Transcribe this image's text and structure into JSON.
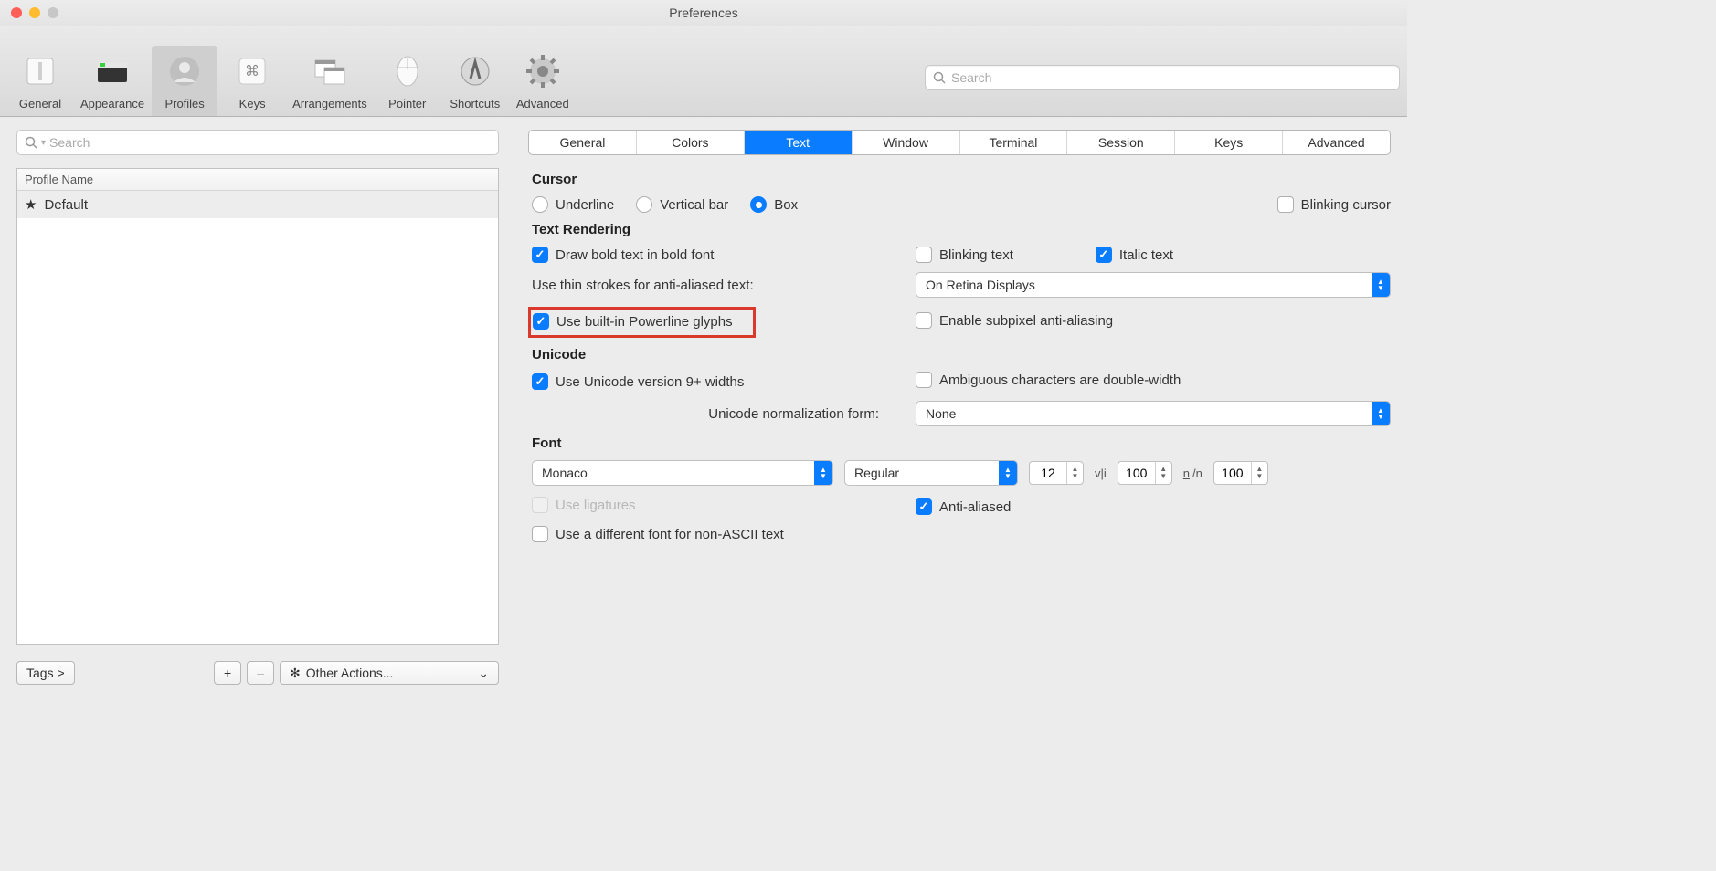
{
  "window_title": "Preferences",
  "toolbar": {
    "items": [
      {
        "label": "General"
      },
      {
        "label": "Appearance"
      },
      {
        "label": "Profiles",
        "selected": true
      },
      {
        "label": "Keys"
      },
      {
        "label": "Arrangements"
      },
      {
        "label": "Pointer"
      },
      {
        "label": "Shortcuts"
      },
      {
        "label": "Advanced"
      }
    ],
    "search_placeholder": "Search"
  },
  "sidebar": {
    "search_placeholder": "Search",
    "profile_header": "Profile Name",
    "profiles": [
      {
        "name": "Default",
        "starred": true
      }
    ],
    "tags_button": "Tags >",
    "add_label": "+",
    "remove_label": "–",
    "other_actions_label": "Other Actions..."
  },
  "tabs": [
    "General",
    "Colors",
    "Text",
    "Window",
    "Terminal",
    "Session",
    "Keys",
    "Advanced"
  ],
  "active_tab": "Text",
  "cursor": {
    "title": "Cursor",
    "options": [
      "Underline",
      "Vertical bar",
      "Box"
    ],
    "selected": "Box",
    "blinking": "Blinking cursor"
  },
  "text_rendering": {
    "title": "Text Rendering",
    "draw_bold": "Draw bold text in bold font",
    "blinking_text": "Blinking text",
    "italic_text": "Italic text",
    "thin_strokes_label": "Use thin strokes for anti-aliased text:",
    "thin_strokes_value": "On Retina Displays",
    "powerline": "Use built-in Powerline glyphs",
    "subpixel": "Enable subpixel anti-aliasing"
  },
  "unicode": {
    "title": "Unicode",
    "v9": "Use Unicode version 9+ widths",
    "ambiguous": "Ambiguous characters are double-width",
    "norm_label": "Unicode normalization form:",
    "norm_value": "None"
  },
  "font": {
    "title": "Font",
    "family": "Monaco",
    "style": "Regular",
    "size": "12",
    "h_spacing": "100",
    "v_spacing": "100",
    "ligatures": "Use ligatures",
    "anti_aliased": "Anti-aliased",
    "different_font": "Use a different font for non-ASCII text"
  }
}
